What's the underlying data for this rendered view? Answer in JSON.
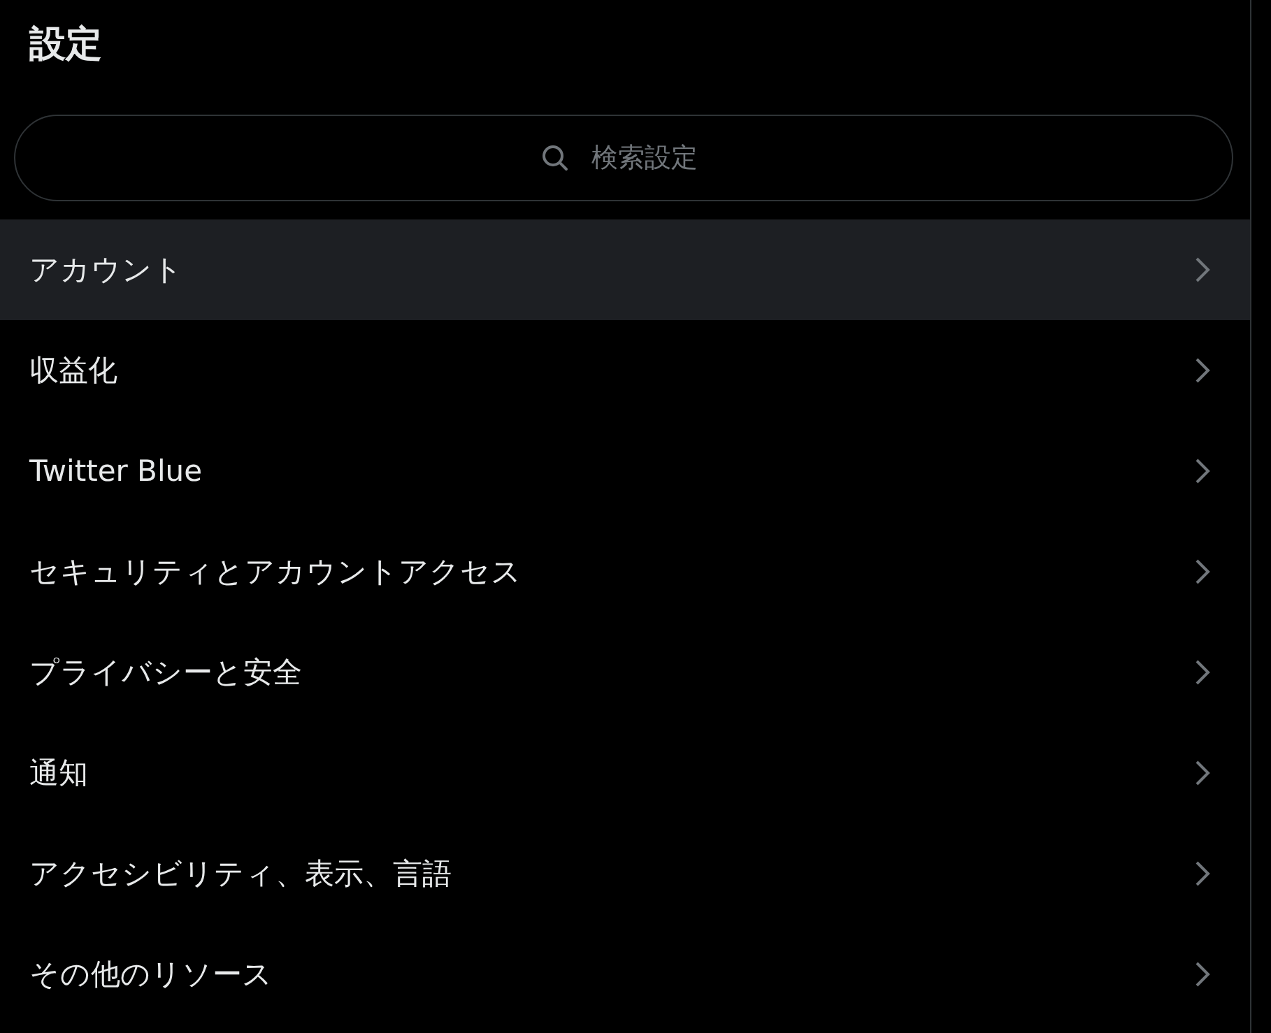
{
  "title": "設定",
  "search": {
    "placeholder": "検索設定"
  },
  "items": [
    {
      "label": "アカウント",
      "selected": true
    },
    {
      "label": "収益化",
      "selected": false
    },
    {
      "label": "Twitter Blue",
      "selected": false
    },
    {
      "label": "セキュリティとアカウントアクセス",
      "selected": false
    },
    {
      "label": "プライバシーと安全",
      "selected": false
    },
    {
      "label": "通知",
      "selected": false
    },
    {
      "label": "アクセシビリティ、表示、言語",
      "selected": false
    },
    {
      "label": "その他のリソース",
      "selected": false
    }
  ]
}
